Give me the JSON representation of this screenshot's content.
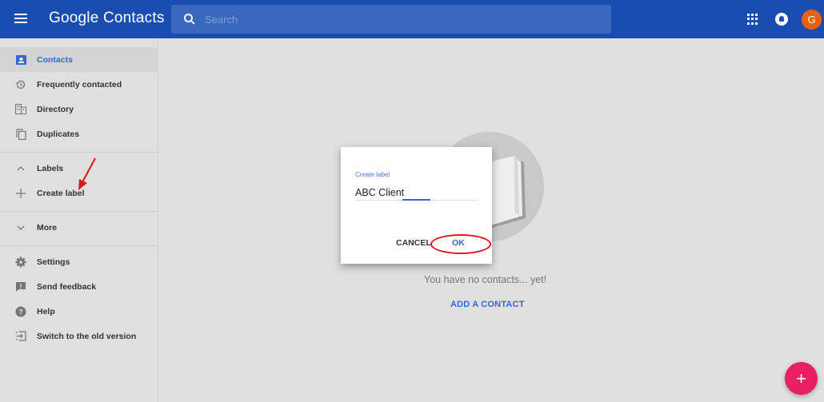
{
  "header": {
    "title": "Google Contacts",
    "search_placeholder": "Search",
    "avatar_letter": "G"
  },
  "sidebar": {
    "items": [
      {
        "label": "Contacts",
        "icon": "contacts-icon",
        "active": true
      },
      {
        "label": "Frequently contacted",
        "icon": "history-icon"
      },
      {
        "label": "Directory",
        "icon": "directory-icon"
      },
      {
        "label": "Duplicates",
        "icon": "duplicates-icon"
      }
    ],
    "labels_section": {
      "label": "Labels",
      "icon": "chevron-up-icon"
    },
    "create_label": {
      "label": "Create label",
      "icon": "plus-icon"
    },
    "more": {
      "label": "More",
      "icon": "chevron-down-icon"
    },
    "footer_items": [
      {
        "label": "Settings",
        "icon": "gear-icon"
      },
      {
        "label": "Send feedback",
        "icon": "feedback-icon"
      },
      {
        "label": "Help",
        "icon": "help-icon"
      },
      {
        "label": "Switch to the old version",
        "icon": "exit-icon"
      }
    ]
  },
  "main": {
    "empty_text": "You have no contacts... yet!",
    "add_contact_label": "ADD A CONTACT"
  },
  "dialog": {
    "field_label": "Create label",
    "field_value": "ABC Client",
    "cancel_label": "CANCEL",
    "ok_label": "OK"
  },
  "fab": {
    "symbol": "+"
  },
  "colors": {
    "header": "#1a4db0",
    "accent": "#3367d6",
    "fab": "#e91e63",
    "avatar": "#e8610e",
    "annotation": "#e0141e"
  }
}
